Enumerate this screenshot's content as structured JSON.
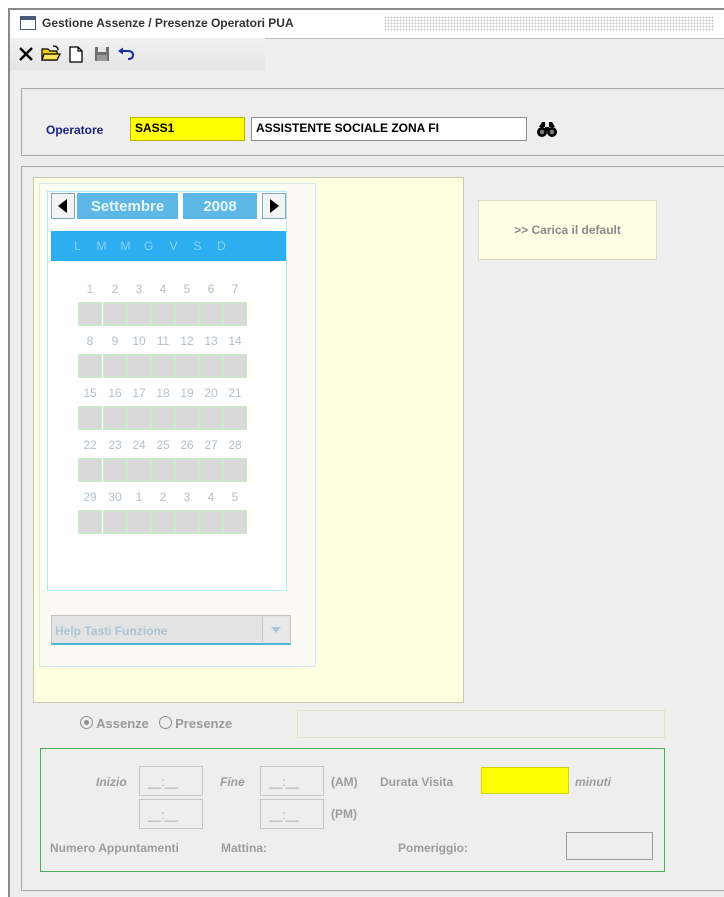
{
  "window": {
    "title": "Gestione Assenze / Presenze Operatori PUA"
  },
  "toolbar": {
    "icons": [
      "close-icon",
      "open-folder-icon",
      "new-document-icon",
      "save-icon",
      "undo-icon"
    ]
  },
  "operatore": {
    "label": "Operatore",
    "code": "SASS1",
    "description": "ASSISTENTE SOCIALE ZONA FI",
    "search_icon": "binoculars-icon"
  },
  "calendar": {
    "month": "Settembre",
    "year": "2008",
    "weekdays": [
      "L",
      "M",
      "M",
      "G",
      "V",
      "S",
      "D"
    ],
    "weeks": [
      [
        "1",
        "2",
        "3",
        "4",
        "5",
        "6",
        "7"
      ],
      [
        "8",
        "9",
        "10",
        "11",
        "12",
        "13",
        "14"
      ],
      [
        "15",
        "16",
        "17",
        "18",
        "19",
        "20",
        "21"
      ],
      [
        "22",
        "23",
        "24",
        "25",
        "26",
        "27",
        "28"
      ],
      [
        "29",
        "30",
        "1",
        "2",
        "3",
        "4",
        "5"
      ]
    ],
    "help_select": "Help Tasti Funzione"
  },
  "actions": {
    "default_button": ">> Carica il default"
  },
  "mode": {
    "assenze": "Assenze",
    "presenze": "Presenze",
    "selected": "Assenze"
  },
  "orari": {
    "inizio_label": "Inizio",
    "fine_label": "Fine",
    "time_placeholder": "__:__",
    "am_label": "(AM)",
    "pm_label": "(PM)",
    "durata_label": "Durata Visita",
    "durata_value": "",
    "minuti_label": "minuti",
    "appuntamenti_label": "Numero Appuntamenti",
    "mattina_label": "Mattina:",
    "pomeriggio_label": "Pomeriggio:"
  },
  "colors": {
    "accent": "#2daef0",
    "highlight": "#ffff00",
    "panel": "#ffffe1"
  }
}
